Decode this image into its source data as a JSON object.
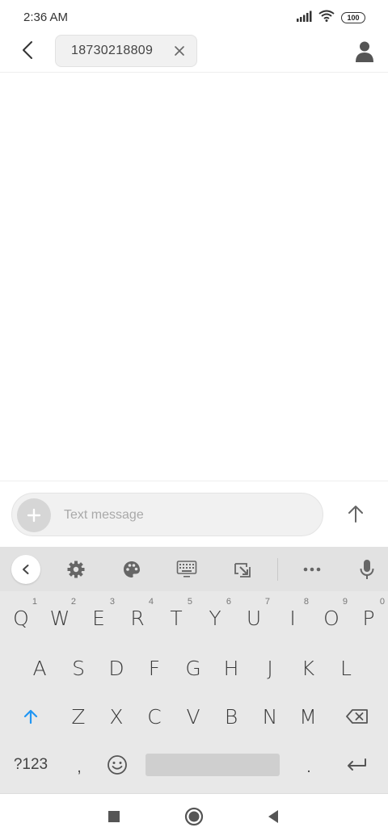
{
  "status_bar": {
    "time": "2:36 AM",
    "battery": "100",
    "icons": [
      "signal-icon",
      "wifi-icon",
      "battery-icon"
    ]
  },
  "header": {
    "back_icon": "chevron-left-icon",
    "recipient": "18730218809",
    "chip_remove_icon": "close-icon",
    "contact_icon": "person-icon"
  },
  "compose": {
    "placeholder": "Text message",
    "value": "",
    "add_icon": "plus-icon",
    "send_icon": "arrow-up-icon"
  },
  "keyboard": {
    "toolbar": [
      "chevron-left-icon",
      "gear-icon",
      "palette-icon",
      "keyboard-icon",
      "resize-icon",
      "more-icon",
      "microphone-icon"
    ],
    "row1": [
      {
        "key": "Q",
        "hint": "1"
      },
      {
        "key": "W",
        "hint": "2"
      },
      {
        "key": "E",
        "hint": "3"
      },
      {
        "key": "R",
        "hint": "4"
      },
      {
        "key": "T",
        "hint": "5"
      },
      {
        "key": "Y",
        "hint": "6"
      },
      {
        "key": "U",
        "hint": "7"
      },
      {
        "key": "I",
        "hint": "8"
      },
      {
        "key": "O",
        "hint": "9"
      },
      {
        "key": "P",
        "hint": "0"
      }
    ],
    "row2": [
      "A",
      "S",
      "D",
      "F",
      "G",
      "H",
      "J",
      "K",
      "L"
    ],
    "row3": [
      "Z",
      "X",
      "C",
      "V",
      "B",
      "N",
      "M"
    ],
    "row4": {
      "symbols": "?123",
      "comma": ",",
      "period": "."
    },
    "shift_icon": "shift-arrow-icon",
    "backspace_icon": "backspace-icon",
    "enter_icon": "enter-icon",
    "accent_color": "#2196f3"
  },
  "nav_bar": [
    "recents-square-icon",
    "home-circle-icon",
    "back-triangle-icon"
  ]
}
